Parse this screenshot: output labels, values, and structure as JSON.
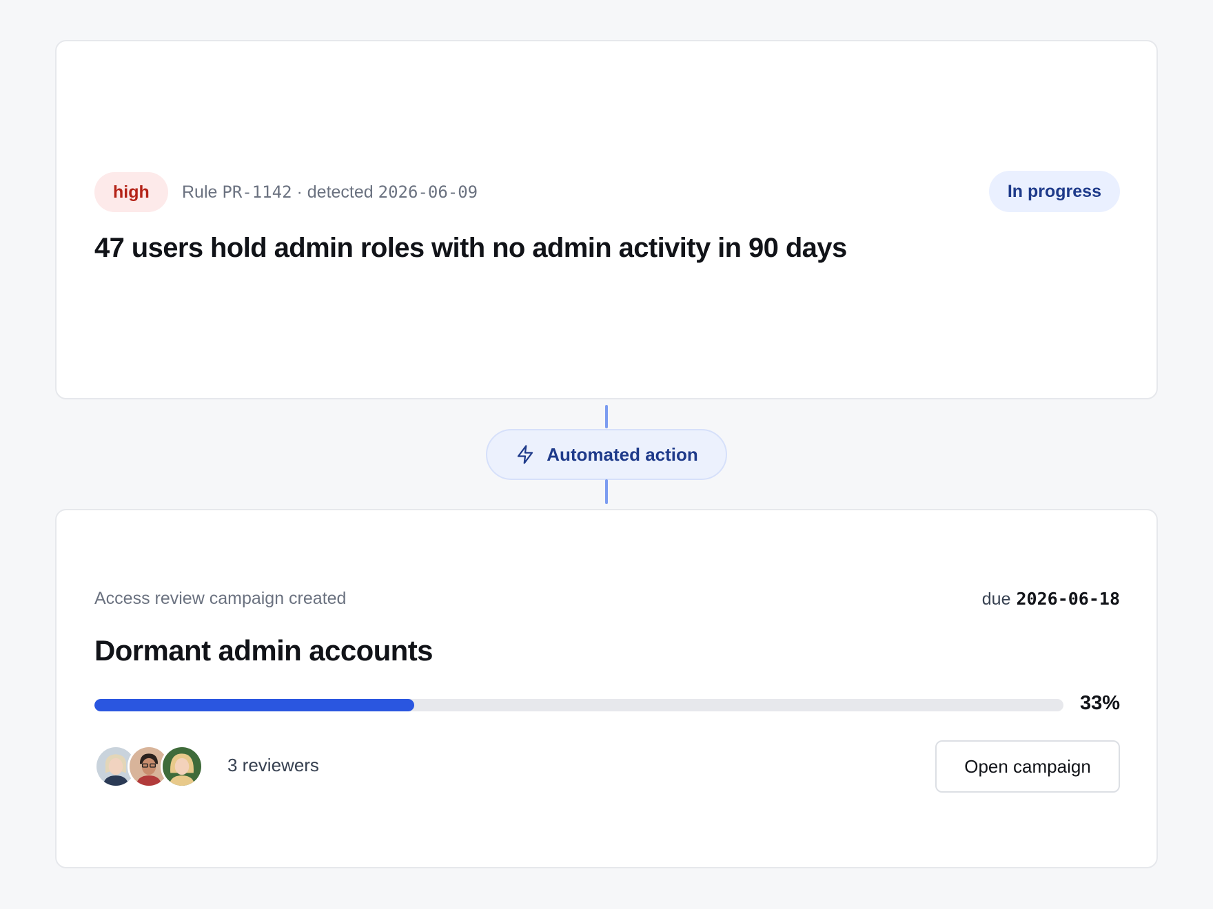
{
  "finding": {
    "severity": "high",
    "rule_prefix": "Rule",
    "rule_id": "PR-1142",
    "separator": "·",
    "detected_prefix": "detected",
    "detected_date": "2026-06-09",
    "status": "In progress",
    "title": "47 users hold admin roles with no admin activity in 90 days",
    "colors": {
      "severity_bg": "#fdeaea",
      "severity_text": "#b42318",
      "status_bg": "#eaf0ff",
      "status_text": "#1e3a8a"
    }
  },
  "connector": {
    "icon": "lightning-bolt-icon",
    "label": "Automated action"
  },
  "campaign": {
    "event_label": "Access review campaign created",
    "due_prefix": "due",
    "due_date": "2026-06-18",
    "title": "Dormant admin accounts",
    "progress_percent": 33,
    "progress_label": "33%",
    "reviewers_label": "3 reviewers",
    "reviewer_avatars": [
      "avatar-reviewer-1",
      "avatar-reviewer-2",
      "avatar-reviewer-3"
    ],
    "open_button": "Open campaign",
    "colors": {
      "progress_fill": "#2a56e0",
      "progress_track": "#e7e8ec"
    }
  }
}
